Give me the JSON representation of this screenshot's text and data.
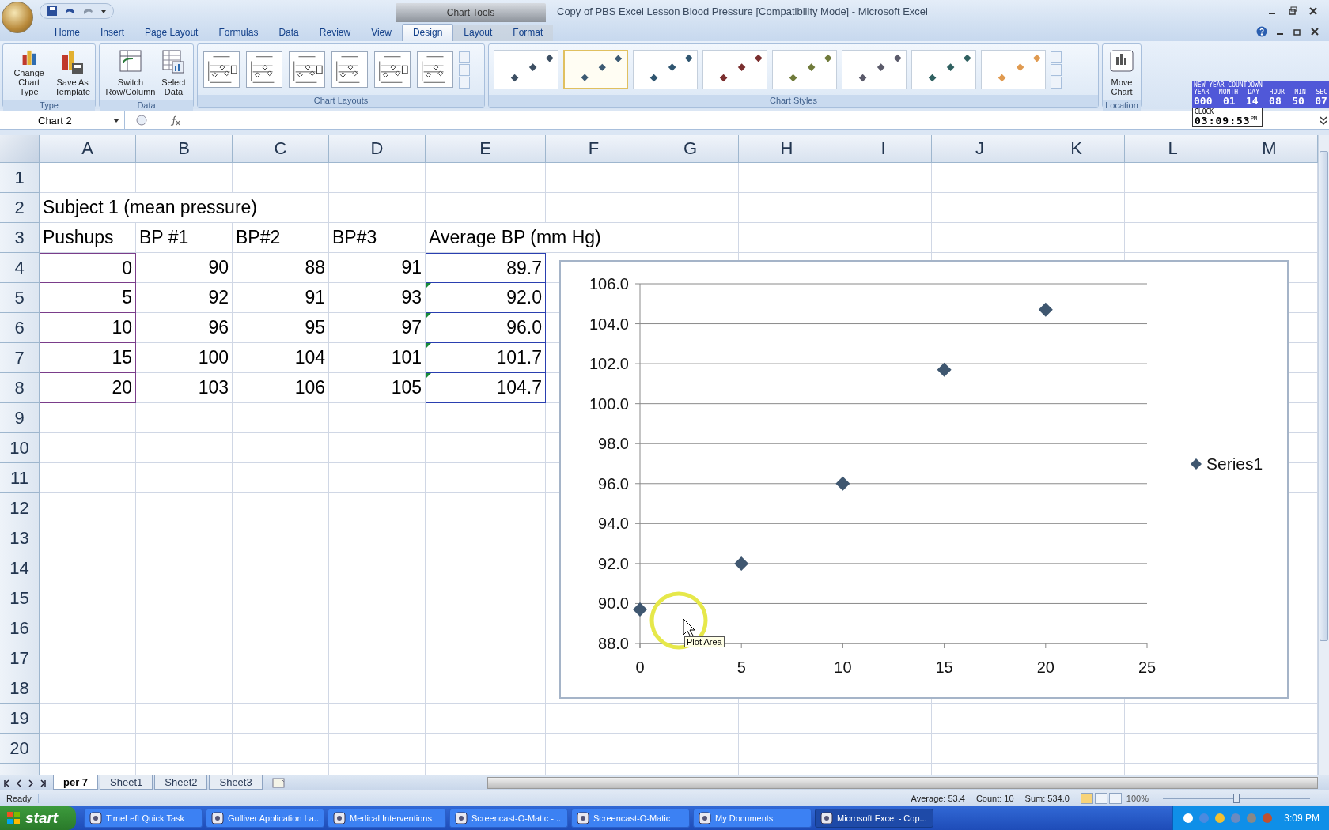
{
  "window": {
    "title": "Copy of PBS Excel Lesson Blood Pressure  [Compatibility Mode] - Microsoft Excel",
    "context_label": "Chart Tools"
  },
  "tabs": [
    {
      "label": "Home",
      "selected": false
    },
    {
      "label": "Insert",
      "selected": false
    },
    {
      "label": "Page Layout",
      "selected": false
    },
    {
      "label": "Formulas",
      "selected": false
    },
    {
      "label": "Data",
      "selected": false
    },
    {
      "label": "Review",
      "selected": false
    },
    {
      "label": "View",
      "selected": false
    },
    {
      "label": "Design",
      "selected": true
    },
    {
      "label": "Layout",
      "selected": false
    },
    {
      "label": "Format",
      "selected": false
    }
  ],
  "ribbon": {
    "groups": [
      {
        "label": "Type",
        "kind": "buttons",
        "buttons": [
          {
            "label": "Change Chart Type",
            "kind": "chart-type"
          },
          {
            "label": "Save As Template",
            "kind": "template"
          }
        ]
      },
      {
        "label": "Data",
        "kind": "buttons",
        "buttons": [
          {
            "label": "Switch Row/Column",
            "kind": "switch"
          },
          {
            "label": "Select Data",
            "kind": "select-data"
          }
        ]
      },
      {
        "label": "Chart Layouts",
        "kind": "layouts",
        "layouts": [
          {
            "selected": false
          },
          {
            "selected": false
          },
          {
            "selected": false
          },
          {
            "selected": false
          },
          {
            "selected": false
          },
          {
            "selected": false
          }
        ]
      },
      {
        "label": "Chart Styles",
        "kind": "styles",
        "styles": [
          {
            "color": "#3c4f63",
            "selected": false
          },
          {
            "color": "#3c5a73",
            "selected": true
          },
          {
            "color": "#2f5570",
            "selected": false
          },
          {
            "color": "#7a2e2e",
            "selected": false
          },
          {
            "color": "#6f7a3a",
            "selected": false
          },
          {
            "color": "#5a5a6a",
            "selected": false
          },
          {
            "color": "#2f6060",
            "selected": false
          },
          {
            "color": "#e09a50",
            "selected": false
          }
        ]
      },
      {
        "label": "Location",
        "kind": "buttons",
        "buttons": [
          {
            "label": "Move Chart",
            "kind": "move"
          }
        ]
      }
    ]
  },
  "countdown": {
    "title": "NEW YEAR COUNTDOWN",
    "units": [
      "YEAR",
      "MONTH",
      "DAY",
      "HOUR",
      "MIN",
      "SEC"
    ],
    "values": [
      "000",
      "01",
      "14",
      "08",
      "50",
      "07"
    ],
    "clock_label": "CLOCK",
    "clock": "03:09:53",
    "clock_suffix": "PM"
  },
  "name_box": "Chart 2",
  "columns": [
    "A",
    "B",
    "C",
    "D",
    "E",
    "F",
    "G",
    "H",
    "I",
    "J",
    "K",
    "L",
    "M"
  ],
  "rows": [
    {
      "number": "1",
      "kind": "labels",
      "cells": []
    },
    {
      "number": "2",
      "kind": "labels",
      "cells": [
        {
          "text": "Subject 1 (mean pressure)"
        }
      ]
    },
    {
      "number": "3",
      "kind": "labels",
      "cells": [
        {
          "text": "Pushups"
        },
        {
          "text": "BP #1"
        },
        {
          "text": "BP#2"
        },
        {
          "text": "BP#3"
        },
        {
          "text": "Average BP (mm Hg)"
        }
      ]
    },
    {
      "number": "4",
      "kind": "numbers",
      "cells": [
        {
          "text": "0",
          "color": "#7a3d8a"
        },
        {
          "text": "90"
        },
        {
          "text": "88"
        },
        {
          "text": "91"
        },
        {
          "text": "89.7",
          "color": "#2a3fb0"
        }
      ]
    },
    {
      "number": "5",
      "kind": "numbers",
      "cells": [
        {
          "text": "5",
          "color": "#7a3d8a"
        },
        {
          "text": "92"
        },
        {
          "text": "91"
        },
        {
          "text": "93"
        },
        {
          "text": "92.0",
          "color": "#2a3fb0",
          "error_flag": true
        }
      ]
    },
    {
      "number": "6",
      "kind": "numbers",
      "cells": [
        {
          "text": "10",
          "color": "#7a3d8a"
        },
        {
          "text": "96"
        },
        {
          "text": "95"
        },
        {
          "text": "97"
        },
        {
          "text": "96.0",
          "color": "#2a3fb0",
          "error_flag": true
        }
      ]
    },
    {
      "number": "7",
      "kind": "numbers",
      "cells": [
        {
          "text": "15",
          "color": "#7a3d8a"
        },
        {
          "text": "100"
        },
        {
          "text": "104"
        },
        {
          "text": "101"
        },
        {
          "text": "101.7",
          "color": "#2a3fb0",
          "error_flag": true
        }
      ]
    },
    {
      "number": "8",
      "kind": "numbers",
      "cells": [
        {
          "text": "20",
          "color": "#7a3d8a"
        },
        {
          "text": "103"
        },
        {
          "text": "106"
        },
        {
          "text": "105"
        },
        {
          "text": "104.7",
          "color": "#2a3fb0",
          "error_flag": true
        }
      ]
    },
    {
      "number": "9",
      "kind": "labels",
      "cells": []
    },
    {
      "number": "10",
      "kind": "labels",
      "cells": []
    },
    {
      "number": "11",
      "kind": "labels",
      "cells": []
    },
    {
      "number": "12",
      "kind": "labels",
      "cells": []
    },
    {
      "number": "13",
      "kind": "labels",
      "cells": []
    },
    {
      "number": "14",
      "kind": "labels",
      "cells": []
    },
    {
      "number": "15",
      "kind": "labels",
      "cells": []
    },
    {
      "number": "16",
      "kind": "labels",
      "cells": []
    },
    {
      "number": "17",
      "kind": "labels",
      "cells": []
    },
    {
      "number": "18",
      "kind": "labels",
      "cells": []
    },
    {
      "number": "19",
      "kind": "labels",
      "cells": []
    },
    {
      "number": "20",
      "kind": "labels",
      "cells": []
    }
  ],
  "chart": {
    "tooltip": "Plot Area",
    "chart_data": {
      "type": "scatter",
      "grid": true,
      "x": [
        0,
        5,
        10,
        15,
        20
      ],
      "series": [
        {
          "name": "Series1",
          "color": "#3f5770",
          "values": [
            89.7,
            92.0,
            96.0,
            101.7,
            104.7
          ]
        }
      ],
      "xlim": [
        0,
        25
      ],
      "ylim": [
        88,
        106
      ],
      "xticks": [
        0,
        5,
        10,
        15,
        20,
        25
      ],
      "yticks": [
        {
          "value": 88,
          "label": "88.0"
        },
        {
          "value": 90,
          "label": "90.0"
        },
        {
          "value": 92,
          "label": "92.0"
        },
        {
          "value": 94,
          "label": "94.0"
        },
        {
          "value": 96,
          "label": "96.0"
        },
        {
          "value": 98,
          "label": "98.0"
        },
        {
          "value": 100,
          "label": "100.0"
        },
        {
          "value": 102,
          "label": "102.0"
        },
        {
          "value": 104,
          "label": "104.0"
        },
        {
          "value": 106,
          "label": "106.0"
        }
      ]
    }
  },
  "sheet_tabs": [
    {
      "label": "per 7",
      "selected": true
    },
    {
      "label": "Sheet1",
      "selected": false
    },
    {
      "label": "Sheet2",
      "selected": false
    },
    {
      "label": "Sheet3",
      "selected": false
    }
  ],
  "status_bar": {
    "mode": "Ready",
    "stats": [
      "Average: 53.4",
      "Count: 10",
      "Sum: 534.0"
    ],
    "zoom": "100%",
    "level": 0.5
  },
  "taskbar": {
    "start": "start",
    "items": [
      {
        "label": "TimeLeft Quick Task",
        "selected": false
      },
      {
        "label": "Gulliver Application La...",
        "selected": false
      },
      {
        "label": "Medical Interventions",
        "selected": false
      },
      {
        "label": "Screencast-O-Matic - ...",
        "selected": false
      },
      {
        "label": "Screencast-O-Matic",
        "selected": false
      },
      {
        "label": "My Documents",
        "selected": false
      },
      {
        "label": "Microsoft Excel - Cop...",
        "selected": true
      }
    ],
    "time": "3:09 PM"
  }
}
